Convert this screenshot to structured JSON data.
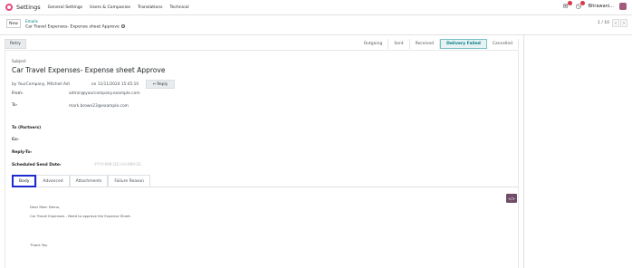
{
  "navbar": {
    "app_name": "Settings",
    "menu": [
      "General Settings",
      "Users & Companies",
      "Translations",
      "Technical"
    ],
    "company": "Bitrawani...",
    "colors": {
      "brand": "#714b67",
      "badge": "#d9364a"
    }
  },
  "control_panel": {
    "new_label": "New",
    "breadcrumb_parent": "Emails",
    "breadcrumb_current": "Car Travel Expenses- Expense sheet Approve",
    "pager": "1 / 10"
  },
  "status_bar": {
    "retry_label": "Retry",
    "stages": [
      "Outgoing",
      "Sent",
      "Received",
      "Delivery Failed",
      "Cancelled"
    ],
    "active_stage": "Delivery Failed"
  },
  "form": {
    "subject_label": "Subject",
    "subject_value": "Car Travel Expenses- Expense sheet Approve",
    "by_line": "by YourCompany, Mitchell Adi",
    "date_line": "on 11/11/2024 15:45:10",
    "reply_label": "Reply",
    "from_label": "From",
    "from_value": "admin@yourcompany.example.com",
    "to_label": "To",
    "to_value": "mark.brown23@example.com",
    "to_partners_label": "To (Partners)",
    "cc_label": "Cc",
    "reply_to_label": "Reply-To",
    "scheduled_label": "Scheduled Send Date",
    "scheduled_placeholder": "YYYY-MM-DD HH:MM:SS"
  },
  "tabs": [
    "Body",
    "Advanced",
    "Attachments",
    "Failure Reason"
  ],
  "active_tab": "Body",
  "body": {
    "greeting": "Dear Marc Demo,",
    "message": "Car Travel Expenses - Need to approve the Expense Sheet.",
    "signoff": "Thank You",
    "codeview_label": "</>"
  }
}
